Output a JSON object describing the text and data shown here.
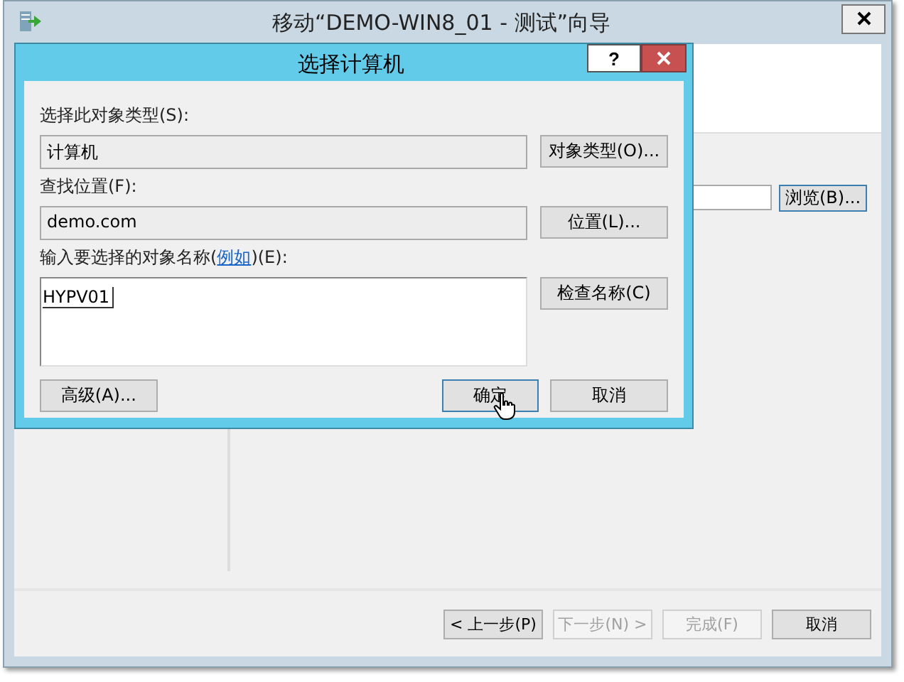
{
  "window": {
    "title": "移动“DEMO-WIN8_01 - 测试”向导"
  },
  "wizard": {
    "browse_button": "浏览(B)...",
    "buttons": [
      {
        "label": "< 上一步(P)",
        "disabled": false
      },
      {
        "label": "下一步(N) >",
        "disabled": true
      },
      {
        "label": "完成(F)",
        "disabled": true
      },
      {
        "label": "取消",
        "disabled": false
      }
    ]
  },
  "dialog": {
    "title": "选择计算机",
    "help": "?",
    "fields": [
      {
        "label": "选择此对象类型(S):",
        "value": "计算机",
        "button": "对象类型(O)..."
      },
      {
        "label": "查找位置(F):",
        "value": "demo.com",
        "button": "位置(L)..."
      }
    ],
    "name_field": {
      "label": "输入要选择的对象名称(",
      "link": "例如",
      "label_end": ")(E):",
      "value": "HYPV01",
      "button": "检查名称(C)"
    },
    "buttons": [
      {
        "label": "高级(A)...",
        "default": false
      },
      {
        "label": "确定",
        "default": true
      },
      {
        "label": "取消",
        "default": false
      }
    ]
  }
}
